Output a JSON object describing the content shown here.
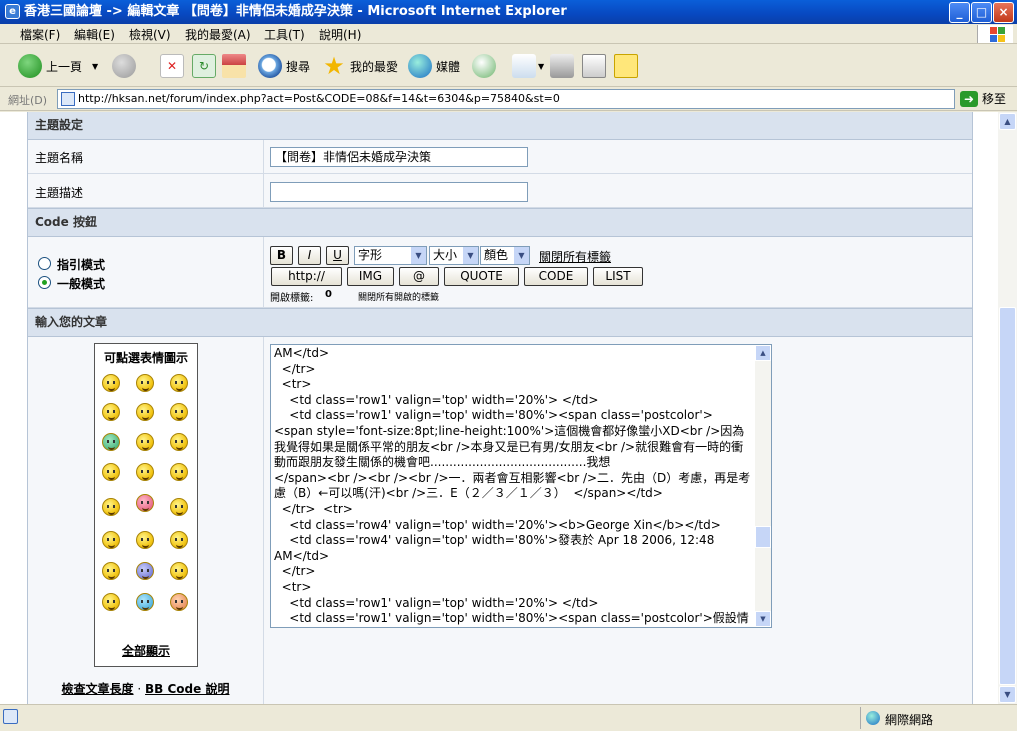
{
  "window": {
    "title": "香港三國論壇 -> 編輯文章 【問卷】非情侶未婚成孕決策 - Microsoft Internet Explorer"
  },
  "menu": [
    "檔案(F)",
    "編輯(E)",
    "檢視(V)",
    "我的最愛(A)",
    "工具(T)",
    "說明(H)"
  ],
  "toolbar": {
    "back": "上一頁",
    "search": "搜尋",
    "favorites": "我的最愛",
    "media": "媒體"
  },
  "address": {
    "label": "網址(D)",
    "url": "http://hksan.net/forum/index.php?act=Post&CODE=08&f=14&t=6304&p=75840&st=0",
    "go": "移至"
  },
  "form": {
    "section_topic": "主題設定",
    "topic_name_label": "主題名稱",
    "topic_name_value": "【問卷】非情侶未婚成孕決策",
    "topic_desc_label": "主題描述",
    "topic_desc_value": "",
    "section_code": "Code 按鈕",
    "mode_guided": "指引模式",
    "mode_normal": "一般模式",
    "fmt_bold": "B",
    "fmt_italic": "I",
    "fmt_underline": "U",
    "font_select": "字形",
    "size_select": "大小",
    "color_select": "顏色",
    "close_all_tags": "關閉所有標籤",
    "code_buttons": [
      "http://",
      "IMG",
      "@",
      "QUOTE",
      "CODE",
      "LIST"
    ],
    "open_tags_label": "開啟標籤:",
    "open_tags_count": "0",
    "close_all_tags_small": "關閉所有開啟的標籤",
    "section_post": "輸入您的文章",
    "emoticons_title": "可點選表情圖示",
    "show_all": "全部顯示",
    "check_length": "檢查文章長度",
    "separator": "·",
    "bb_help": "BB Code 說明"
  },
  "post_text": "AM</td>\n  </tr>\n  <tr>\n    <td class='row1' valign='top' width='20%'> </td>\n    <td class='row1' valign='top' width='80%'><span class='postcolor'>\n<span style='font-size:8pt;line-height:100%'>這個機會都好像蠻小XD<br />因為我覺得如果是關係平常的朋友<br />本身又是已有男/女朋友<br />就很難會有一時的衝動而跟朋友發生關係的機會吧.........................................我想\n</span><br /><br /><br />一．兩者會互相影響<br />二．先由（D）考慮，再是考慮（B）←可以嗎(汗)<br />三．E（２／３／１／３）  </span></td>\n  </tr>  <tr>\n    <td class='row4' valign='top' width='20%'><b>George Xin</b></td>\n    <td class='row4' valign='top' width='80%'>發表於 Apr 18 2006, 12:48\nAM</td>\n  </tr>\n  <tr>\n    <td class='row1' valign='top' width='20%'> </td>\n    <td class='row1' valign='top' width='80%'><span class='postcolor'>假設情景：<br />男女雙方一時衝動做錯事，發生了關係，然後女方懷孕了。雙方原來就是互",
  "status": {
    "zone": "網際網路"
  }
}
